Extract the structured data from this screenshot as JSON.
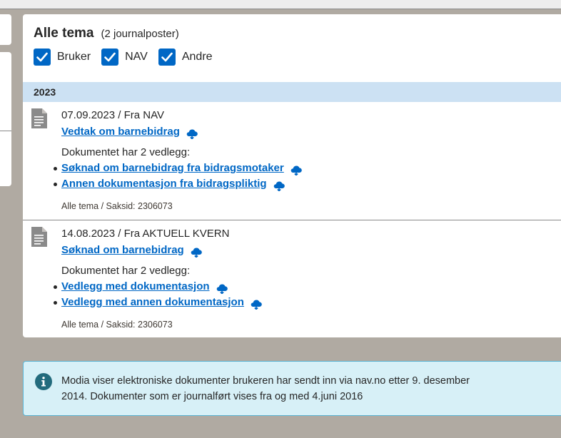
{
  "header": {
    "title": "Alle tema",
    "count": "(2 journalposter)"
  },
  "filters": [
    {
      "label": "Bruker",
      "checked": true
    },
    {
      "label": "NAV",
      "checked": true
    },
    {
      "label": "Andre",
      "checked": true
    }
  ],
  "year": "2023",
  "entries": [
    {
      "date_from": "07.09.2023 / Fra NAV",
      "title": "Vedtak om barnebidrag",
      "attachments_info": "Dokumentet har 2 vedlegg:",
      "attachments": [
        "Søknad om barnebidrag fra bidragsmotaker",
        "Annen dokumentasjon fra bidragspliktig"
      ],
      "meta": "Alle tema / Saksid: 2306073"
    },
    {
      "date_from": "14.08.2023 / Fra AKTUELL KVERN",
      "title": "Søknad om barnebidrag",
      "attachments_info": "Dokumentet har 2 vedlegg:",
      "attachments": [
        "Vedlegg med dokumentasjon",
        "Vedlegg med annen dokumentasjon"
      ],
      "meta": "Alle tema / Saksid: 2306073"
    }
  ],
  "info": {
    "line1": "Modia viser elektroniske dokumenter brukeren har sendt inn via nav.no etter 9. desember",
    "line2": "2014. Dokumenter som er journalført vises fra og med 4.juni 2016"
  },
  "icons": {
    "document": "document-icon",
    "download": "cloud-download-icon",
    "info": "info-icon",
    "checkbox": "checkmark-icon"
  },
  "colors": {
    "link": "#0067c5",
    "year_bar": "#cce1f3",
    "info_bg": "#d7f0f7",
    "info_border": "#5ab5d5",
    "backdrop": "#b0aaa2"
  }
}
